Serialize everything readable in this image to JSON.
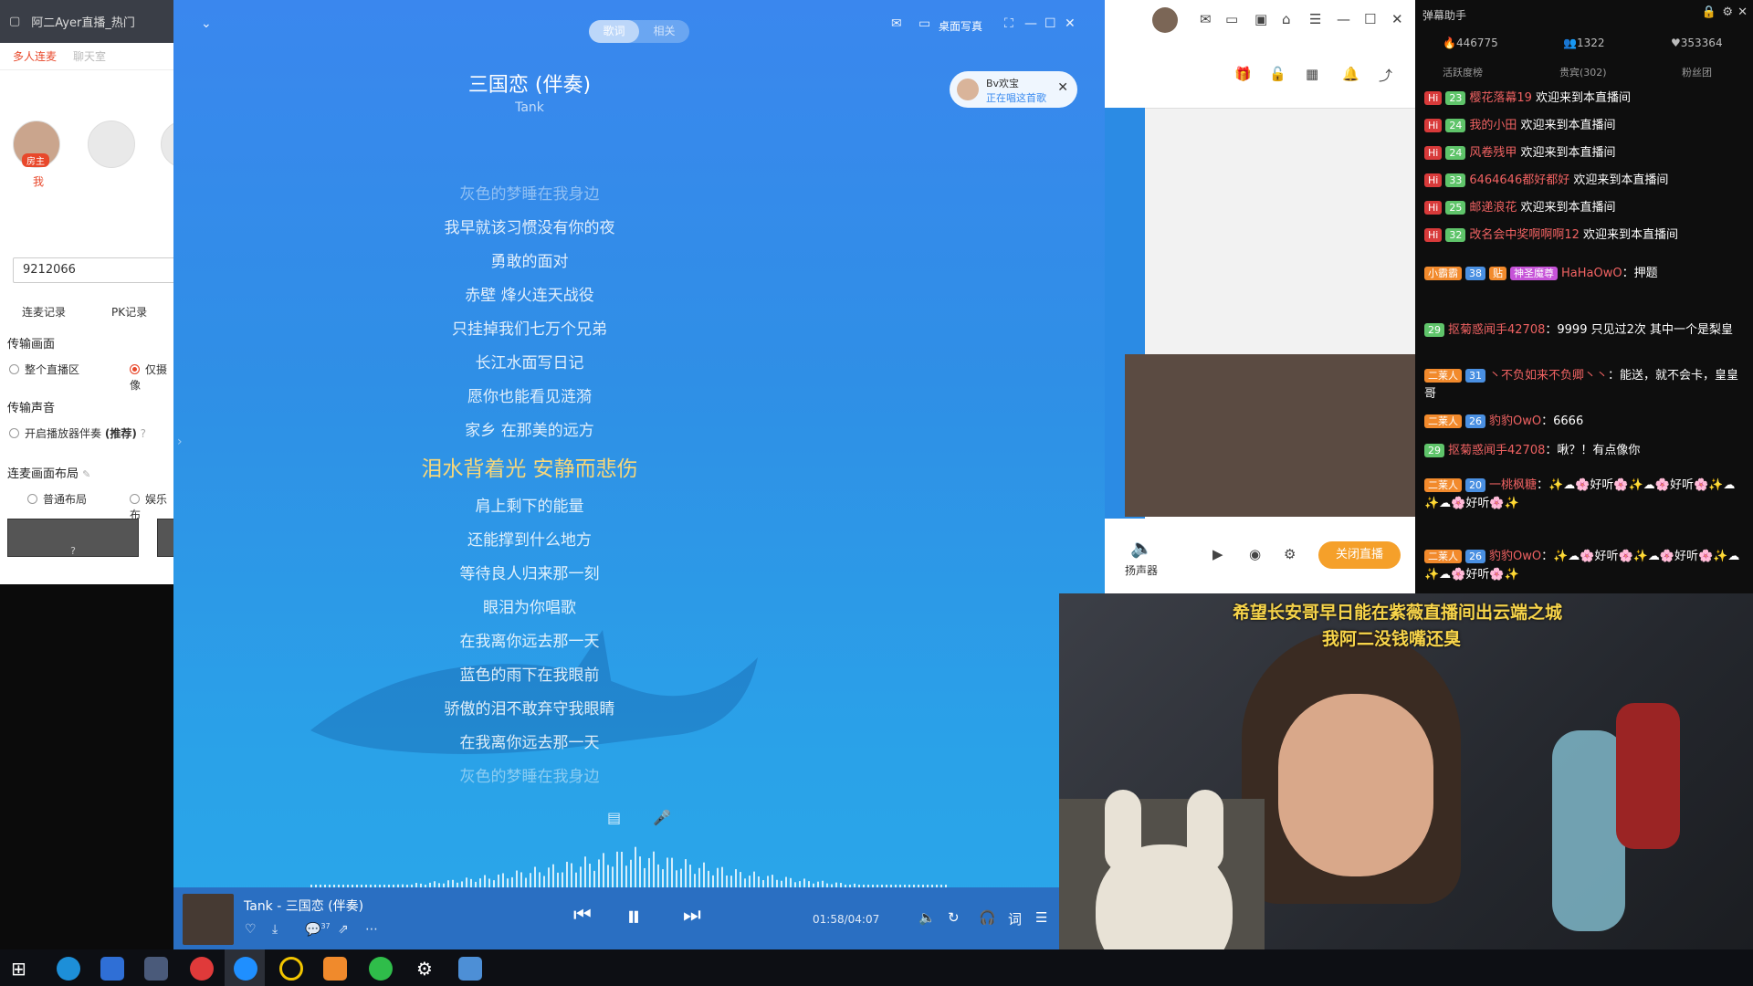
{
  "left_panel": {
    "window_title": "阿二Ayer直播_热门",
    "tabs": [
      "多人连麦",
      "聊天室"
    ],
    "host_badge": "房主",
    "me_label": "我",
    "room_id": "9212066",
    "records": [
      "连麦记录",
      "PK记录"
    ],
    "transfer_picture": "传输画面",
    "picture_options": [
      "整个直播区",
      "仅摄像"
    ],
    "transfer_sound": "传输声音",
    "sound_option": "开启播放器伴奏",
    "sound_option_tag": "(推荐)",
    "layout_title": "连麦画面布局",
    "layout_options": [
      "普通布局",
      "娱乐布"
    ],
    "bottom_btn": "?"
  },
  "player": {
    "tabs": [
      "歌词",
      "相关"
    ],
    "active_tab": "歌词",
    "desktop_lyrics": "桌面写真",
    "song_title": "三国恋 (伴奏)",
    "artist": "Tank",
    "singer": {
      "name": "Bv欢宝",
      "status": "正在唱这首歌"
    },
    "lyrics": [
      {
        "text": "灰色的梦睡在我身边",
        "state": "dim"
      },
      {
        "text": "我早就该习惯没有你的夜",
        "state": "normal"
      },
      {
        "text": "勇敢的面对",
        "state": "normal"
      },
      {
        "text": "赤壁 烽火连天战役",
        "state": "normal"
      },
      {
        "text": "只挂掉我们七万个兄弟",
        "state": "normal"
      },
      {
        "text": "长江水面写日记",
        "state": "normal"
      },
      {
        "text": "愿你也能看见涟漪",
        "state": "normal"
      },
      {
        "text": "家乡 在那美的远方",
        "state": "normal"
      },
      {
        "text": "泪水背着光 安静而悲伤",
        "state": "current"
      },
      {
        "text": "肩上剩下的能量",
        "state": "normal"
      },
      {
        "text": "还能撑到什么地方",
        "state": "normal"
      },
      {
        "text": "等待良人归来那一刻",
        "state": "normal"
      },
      {
        "text": "眼泪为你唱歌",
        "state": "normal"
      },
      {
        "text": "在我离你远去那一天",
        "state": "normal"
      },
      {
        "text": "蓝色的雨下在我眼前",
        "state": "normal"
      },
      {
        "text": "骄傲的泪不敢弃守我眼睛",
        "state": "normal"
      },
      {
        "text": "在我离你远去那一天",
        "state": "normal"
      },
      {
        "text": "灰色的梦睡在我身边",
        "state": "dim"
      }
    ],
    "now_playing": "Tank - 三国恋 (伴奏)",
    "comment_count": "37",
    "time": "01:58/04:07",
    "lyric_btn": "词",
    "accent": "#f7d77a"
  },
  "live_panel": {
    "speaker_label": "扬声器",
    "close_live": "关闭直播",
    "accent": "#f5a02a"
  },
  "danmu": {
    "title": "弹幕助手",
    "stats": {
      "popularity": "446775",
      "fans": "1322",
      "likes": "353364"
    },
    "tabs": [
      "活跃度榜",
      "贵宾(302)",
      "粉丝团"
    ],
    "enter_rows": [
      {
        "level": "23",
        "name": "樱花落幕19",
        "msg": "欢迎来到本直播间"
      },
      {
        "level": "24",
        "name": "我的小田",
        "msg": "欢迎来到本直播间"
      },
      {
        "level": "24",
        "name": "风卷残甲",
        "msg": "欢迎来到本直播间"
      },
      {
        "level": "33",
        "name": "6464646都好都好",
        "msg": "欢迎来到本直播间"
      },
      {
        "level": "25",
        "name": "邮递浪花",
        "msg": "欢迎来到本直播间"
      },
      {
        "level": "32",
        "name": "改名会中奖啊啊啊12",
        "msg": "欢迎来到本直播间"
      }
    ],
    "chat": [
      {
        "badges": [
          "小霸霸",
          "38",
          "贴",
          "神圣魔尊"
        ],
        "name": "HaHaOwO",
        "msg": "押题"
      },
      {
        "badges": [
          "29"
        ],
        "name": "抠菊惑闻手42708",
        "msg": "9999 只见过2次 其中一个是梨皇"
      },
      {
        "badges": [
          "二莱人",
          "31"
        ],
        "name": "丶不负如来不负卿丶丶",
        "msg": "能送，就不会卡，皇皇哥"
      },
      {
        "badges": [
          "二莱人",
          "26"
        ],
        "name": "豹豹OwO",
        "msg": "6666"
      },
      {
        "badges": [
          "29"
        ],
        "name": "抠菊惑闻手42708",
        "msg": "啾？！有点像你"
      },
      {
        "badges": [
          "二莱人",
          "20"
        ],
        "name": "一桃枫糖",
        "msg": "✨☁🌸好听🌸✨☁🌸好听🌸✨☁✨☁🌸好听🌸✨"
      },
      {
        "badges": [
          "二莱人",
          "26"
        ],
        "name": "豹豹OwO",
        "msg": "✨☁🌸好听🌸✨☁🌸好听🌸✨☁✨☁🌸好听🌸✨"
      }
    ]
  },
  "webcam": {
    "caption_line1": "希望长安哥早日能在紫薇直播间出云端之城",
    "caption_line2": "我阿二没钱嘴还臭"
  },
  "taskbar": {
    "icons": [
      "windows-start",
      "edge",
      "teamviewer",
      "app-bird",
      "netease-music",
      "kugou",
      "app-yellow",
      "app-orange",
      "wechat",
      "settings",
      "explorer"
    ]
  }
}
